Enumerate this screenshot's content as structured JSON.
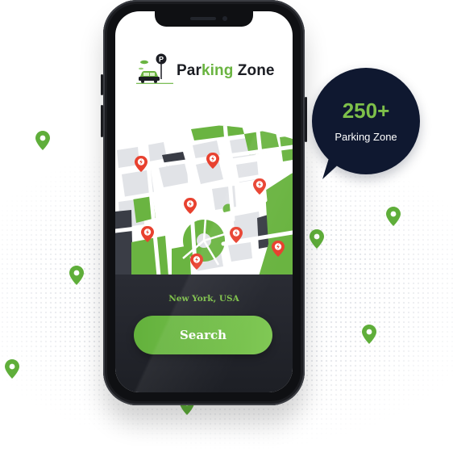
{
  "brand": {
    "name_part1": "Par",
    "name_accent": "king",
    "name_part2": " Zone",
    "logo_icon": "parking-car-logo-icon",
    "accent_color": "#6ab441",
    "dark_color": "#1b1d23"
  },
  "map": {
    "pin_icon": "parking-location-pin-icon",
    "pin_color": "#e8412f",
    "park_color": "#6ab441"
  },
  "search_panel": {
    "location": "New York, USA",
    "button_label": "Search",
    "button_color": "#6ab441"
  },
  "stats_bubble": {
    "count": "250+",
    "label": "Parking Zone",
    "bg_color": "#0f1830"
  },
  "background": {
    "pin_icon": "location-pin-icon",
    "pin_color": "#5fae3a"
  }
}
